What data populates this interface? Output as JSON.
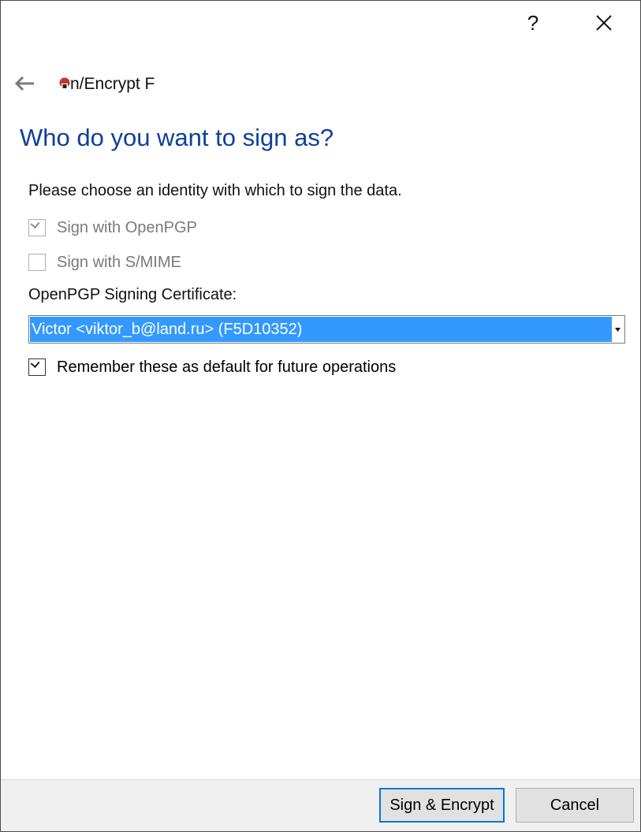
{
  "window": {
    "help_glyph": "?",
    "close_icon": "close-icon"
  },
  "wizard": {
    "back_icon": "arrow-left-icon",
    "app_icon": "kleopatra-icon",
    "title": "n/Encrypt F"
  },
  "page": {
    "heading": "Who do you want to sign as?",
    "instruction": "Please choose an identity with which to sign the data."
  },
  "options": {
    "sign_openpgp": {
      "label": "Sign with OpenPGP",
      "checked": true,
      "enabled": false
    },
    "sign_smime": {
      "label": "Sign with S/MIME",
      "checked": false,
      "enabled": false
    },
    "remember_default": {
      "label": "Remember these as default for future operations",
      "checked": true,
      "enabled": true
    }
  },
  "certificate": {
    "label": "OpenPGP Signing Certificate:",
    "selected": "Victor <viktor_b@land.ru> (F5D10352)"
  },
  "footer": {
    "primary_label": "Sign & Encrypt",
    "cancel_label": "Cancel"
  },
  "colors": {
    "heading": "#0f3f9a",
    "selection": "#3399ff",
    "default_button_border": "#0078d7"
  }
}
